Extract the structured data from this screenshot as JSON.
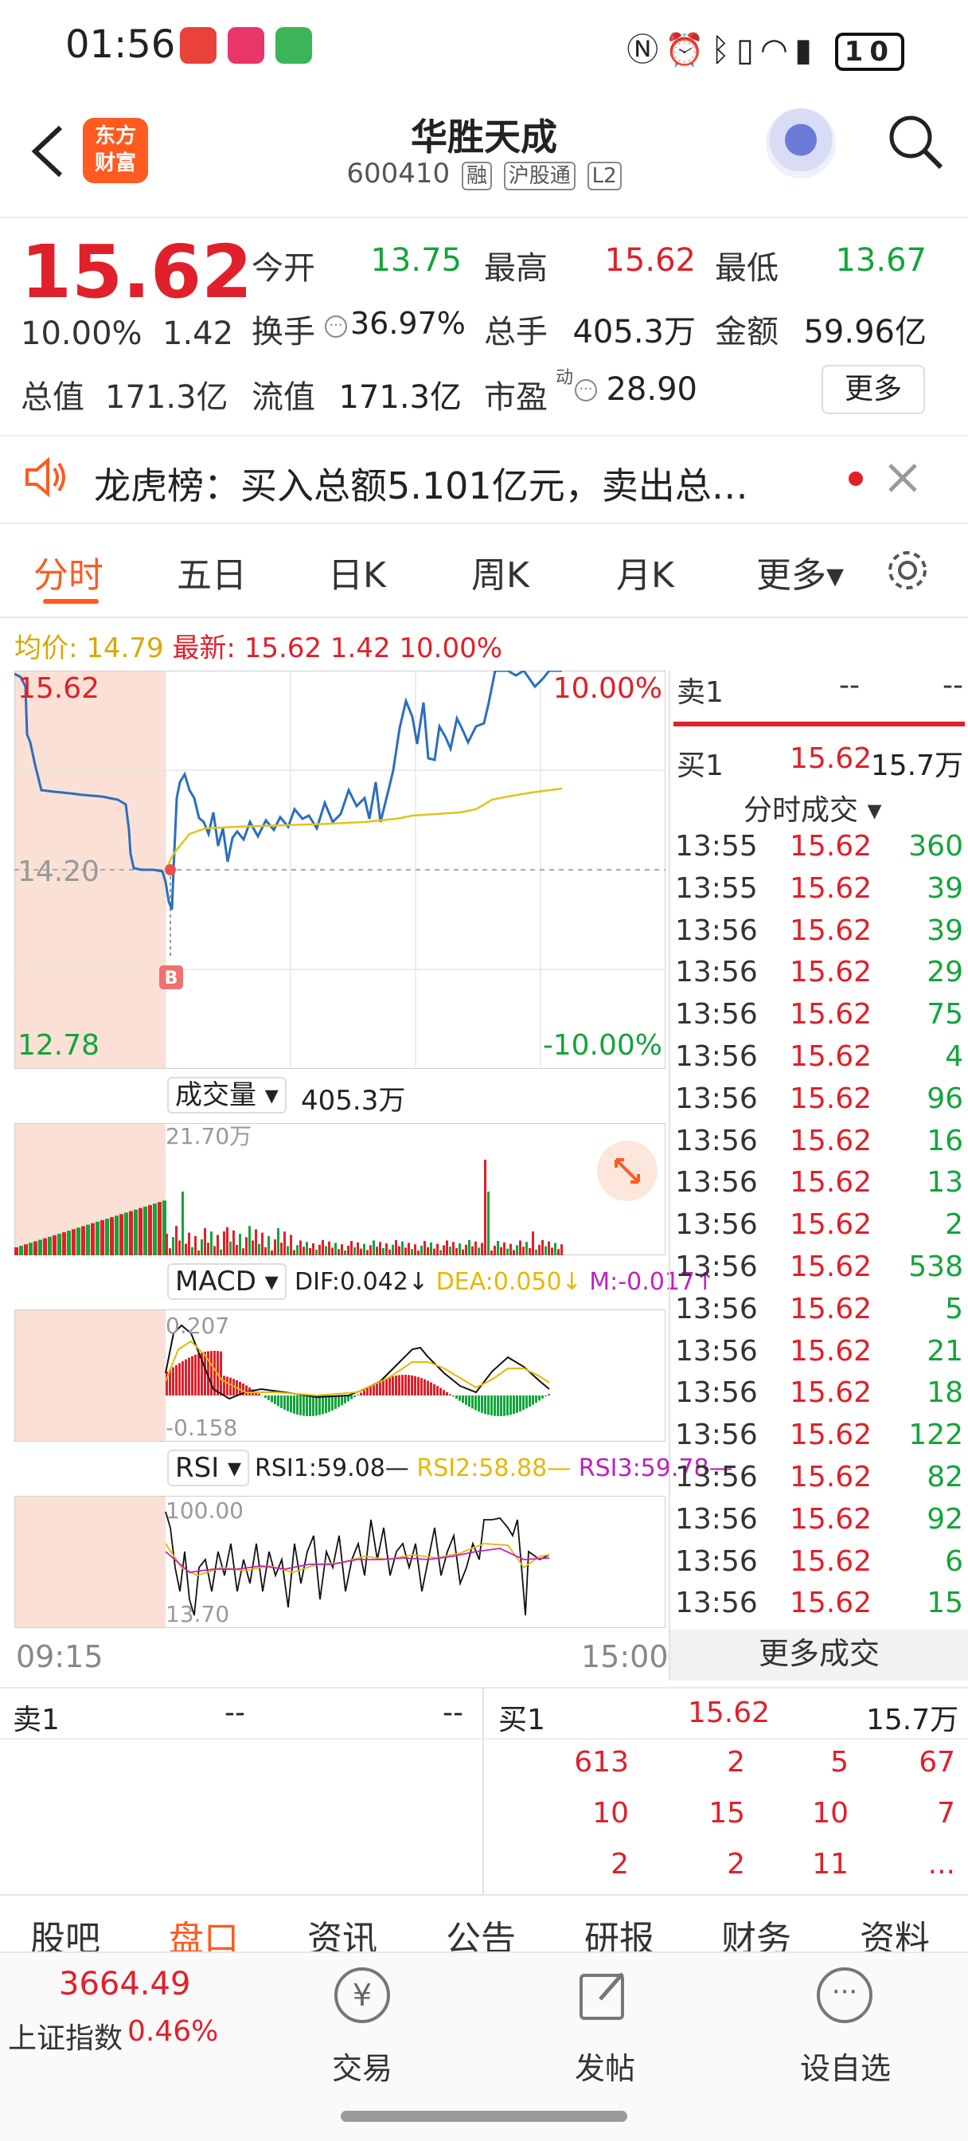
{
  "status_bar": {
    "time": "01:56",
    "battery": "10"
  },
  "header": {
    "back_icon": "chevron-left-icon",
    "logo_text_1": "东方",
    "logo_text_2": "财富",
    "title": "华胜天成",
    "code": "600410",
    "tags": [
      "融",
      "沪股通",
      "L2"
    ]
  },
  "quote": {
    "price": "15.62",
    "change_pct": "10.00%",
    "change": "1.42",
    "open_label": "今开",
    "open": "13.75",
    "high_label": "最高",
    "high": "15.62",
    "low_label": "最低",
    "low": "13.67",
    "turnover_label": "换手",
    "turnover": "36.97%",
    "volume_label": "总手",
    "volume": "405.3万",
    "amount_label": "金额",
    "amount": "59.96亿",
    "mktcap_label": "总值",
    "mktcap": "171.3亿",
    "float_label": "流值",
    "float": "171.3亿",
    "pe_label": "市盈",
    "pe_sup": "动",
    "pe": "28.90",
    "more_label": "更多"
  },
  "notice": {
    "text": "龙虎榜：买入总额5.101亿元，卖出总…"
  },
  "tabs": [
    "分时",
    "五日",
    "日K",
    "周K",
    "月K",
    "更多▾"
  ],
  "legend": {
    "avg_label": "均价:",
    "avg": "14.79",
    "latest_label": "最新:",
    "latest": "15.62",
    "change": "1.42",
    "pct": "10.00%"
  },
  "chart": {
    "price_max": "15.62",
    "price_mid": "14.20",
    "price_min": "12.78",
    "pct_max": "10.00%",
    "pct_min": "-10.00%",
    "b_marker": "B",
    "vol_label": "成交量",
    "vol_value": "405.3万",
    "vol_max": "21.70万",
    "macd_label": "MACD",
    "dif": "DIF:0.042↓",
    "dea": "DEA:0.050↓",
    "m": "M:-0.017↑",
    "macd_max": "0.207",
    "macd_min": "-0.158",
    "rsi_label": "RSI",
    "rsi1": "RSI1:59.08—",
    "rsi2": "RSI2:58.88—",
    "rsi3": "RSI3:59.78—",
    "rsi_max": "100.00",
    "rsi_min": "13.70",
    "time_start": "09:15",
    "time_end": "15:00"
  },
  "side": {
    "sell1_label": "卖1",
    "sell1_price": "--",
    "sell1_vol": "--",
    "buy1_label": "买1",
    "buy1_price": "15.62",
    "buy1_vol": "15.7万",
    "ticks_title": "分时成交 ▾",
    "ticks": [
      [
        "13:55",
        "15.62",
        "360"
      ],
      [
        "13:55",
        "15.62",
        "39"
      ],
      [
        "13:56",
        "15.62",
        "39"
      ],
      [
        "13:56",
        "15.62",
        "29"
      ],
      [
        "13:56",
        "15.62",
        "75"
      ],
      [
        "13:56",
        "15.62",
        "4"
      ],
      [
        "13:56",
        "15.62",
        "96"
      ],
      [
        "13:56",
        "15.62",
        "16"
      ],
      [
        "13:56",
        "15.62",
        "13"
      ],
      [
        "13:56",
        "15.62",
        "2"
      ],
      [
        "13:56",
        "15.62",
        "538"
      ],
      [
        "13:56",
        "15.62",
        "5"
      ],
      [
        "13:56",
        "15.62",
        "21"
      ],
      [
        "13:56",
        "15.62",
        "18"
      ],
      [
        "13:56",
        "15.62",
        "122"
      ],
      [
        "13:56",
        "15.62",
        "82"
      ],
      [
        "13:56",
        "15.62",
        "92"
      ],
      [
        "13:56",
        "15.62",
        "6"
      ],
      [
        "13:56",
        "15.62",
        "15"
      ]
    ],
    "more_ticks": "更多成交"
  },
  "orderbook": {
    "sell1_label": "卖1",
    "sell1_price": "--",
    "sell1_vol": "--",
    "buy1_label": "买1",
    "buy1_price": "15.62",
    "buy1_vol": "15.7万",
    "queue": [
      [
        "613",
        "2",
        "5",
        "67"
      ],
      [
        "10",
        "15",
        "10",
        "7"
      ],
      [
        "2",
        "2",
        "11",
        "..."
      ]
    ]
  },
  "bottom_tabs": [
    "股吧",
    "盘口",
    "资讯",
    "公告",
    "研报",
    "财务",
    "资料"
  ],
  "footer": {
    "index_value": "3664.49",
    "index_name": "上证指数",
    "index_pct": "0.46%",
    "trade": "交易",
    "post": "发帖",
    "watch": "设自选"
  },
  "colors": {
    "red": "#e0202a",
    "green": "#12a53a",
    "orange": "#ff5a1f",
    "price_line": "#2a6ebf",
    "avg_line": "#e6c21a",
    "pink": "#fbe0d6"
  }
}
